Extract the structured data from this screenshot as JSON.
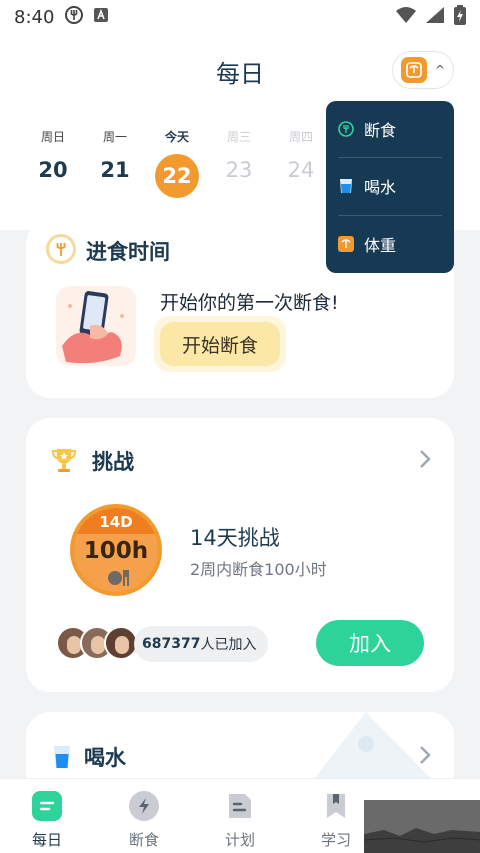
{
  "status_bar": {
    "time": "8:40"
  },
  "header": {
    "title": "每日"
  },
  "week": [
    {
      "name": "周日",
      "date": "20",
      "state": "normal"
    },
    {
      "name": "周一",
      "date": "21",
      "state": "normal"
    },
    {
      "name": "今天",
      "date": "22",
      "state": "active"
    },
    {
      "name": "周三",
      "date": "23",
      "state": "faded"
    },
    {
      "name": "周四",
      "date": "24",
      "state": "faded"
    }
  ],
  "popup_menu": {
    "items": [
      {
        "label": "断食",
        "icon": "fork-ring-icon"
      },
      {
        "label": "喝水",
        "icon": "water-cup-icon"
      },
      {
        "label": "体重",
        "icon": "scale-icon"
      }
    ]
  },
  "fasting_card": {
    "title": "进食时间",
    "prompt": "开始你的第一次断食!",
    "button": "开始断食"
  },
  "challenge_card": {
    "title": "挑战",
    "badge_top": "14D",
    "badge_main": "100h",
    "name": "14天挑战",
    "description": "2周内断食100小时",
    "participants_count": "687377",
    "participants_suffix": "人已加入",
    "join_button": "加入"
  },
  "water_card": {
    "title": "喝水"
  },
  "bottom_nav": [
    {
      "label": "每日",
      "icon": "daily-icon",
      "active": true
    },
    {
      "label": "断食",
      "icon": "lightning-icon",
      "active": false
    },
    {
      "label": "计划",
      "icon": "plan-icon",
      "active": false
    },
    {
      "label": "学习",
      "icon": "bookmark-icon",
      "active": false
    }
  ],
  "colors": {
    "accent_orange": "#f29a2e",
    "accent_green": "#2ed39a",
    "popup_bg": "#163a54",
    "title_navy": "#1d3a50"
  }
}
